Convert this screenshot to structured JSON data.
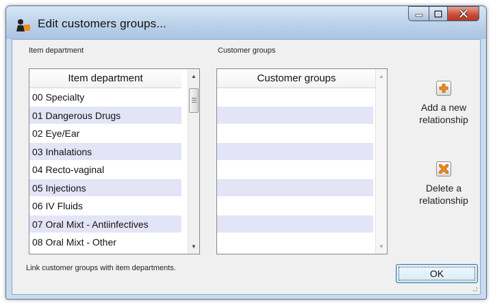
{
  "window": {
    "title": "Edit customers groups...",
    "caption_buttons": [
      "minimize",
      "maximize",
      "close"
    ]
  },
  "left_panel": {
    "group_label": "Item department",
    "column_header": "Item department",
    "items": [
      "00 Specialty",
      "01 Dangerous Drugs",
      "02 Eye/Ear",
      "03 Inhalations",
      "04 Recto-vaginal",
      "05 Injections",
      "06 IV Fluids",
      "07 Oral Mixt - Antiinfectives",
      "08 Oral Mixt - Other"
    ]
  },
  "right_panel": {
    "group_label": "Customer groups",
    "column_header": "Customer groups",
    "items": [
      "",
      "",
      "",
      "",
      "",
      "",
      "",
      "",
      ""
    ]
  },
  "actions": {
    "add_label_line1": "Add a new",
    "add_label_line2": "relationship",
    "add_icon": "plus-icon",
    "delete_label_line1": "Delete a",
    "delete_label_line2": "relationship",
    "delete_icon": "delete-x-icon"
  },
  "footer": {
    "hint": "Link customer groups with item departments.",
    "ok_label": "OK"
  },
  "colors": {
    "row_alt": "#e4e4f7",
    "icon_orange": "#f08a1c",
    "close_red": "#c94a33",
    "window_frame": "#c9dbee"
  }
}
